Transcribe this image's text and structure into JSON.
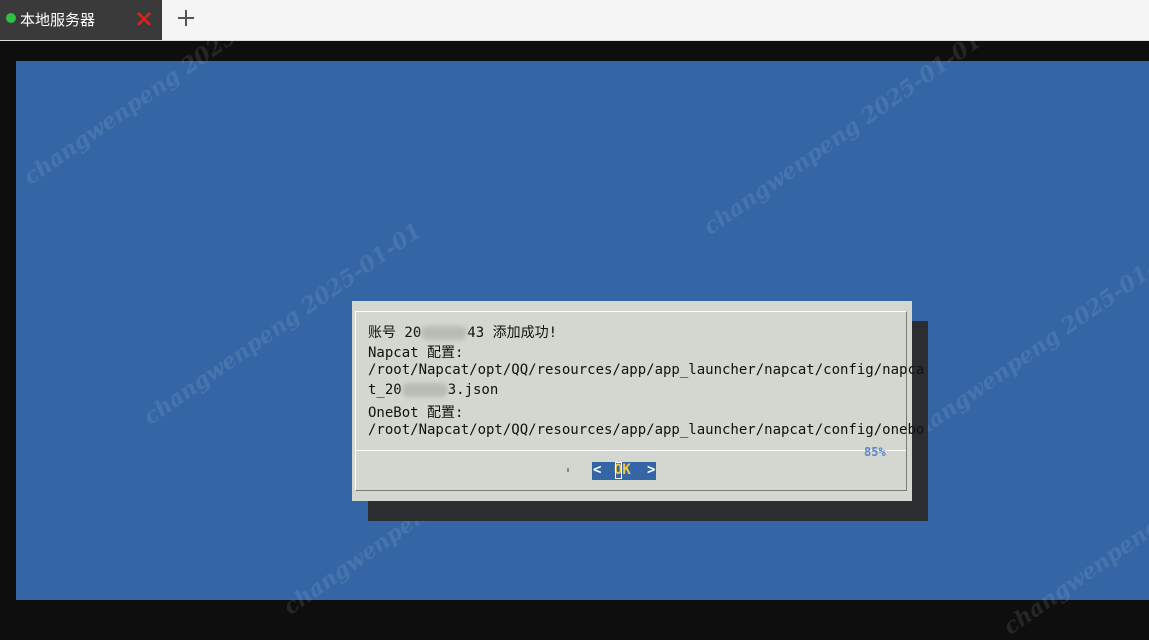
{
  "tabs": [
    {
      "title": "本地服务器",
      "status_color": "#2fbf45",
      "close_color": "#e02020",
      "active": true
    }
  ],
  "new_tab_icon": "plus-icon",
  "watermark": "changwenpeng 2025-01-01",
  "dialog": {
    "lines": {
      "account_prefix": "账号 20",
      "account_suffix": "43 添加成功!",
      "napcat_label": "Napcat 配置:",
      "napcat_path": "/root/Napcat/opt/QQ/resources/app/app_launcher/napcat/config/napca",
      "napcat_file_prefix": "t_20",
      "napcat_file_suffix": "3.json",
      "onebot_label": "OneBot 配置:",
      "onebot_path": "/root/Napcat/opt/QQ/resources/app/app_launcher/napcat/config/onebo"
    },
    "scroll_percent": "85%",
    "ok_button": {
      "left": "<",
      "label": "OK",
      "right": ">"
    }
  },
  "colors": {
    "screen_bg": "#3465a4",
    "dialog_bg": "#d3d7cf",
    "ok_highlight": "#f2c94c"
  }
}
